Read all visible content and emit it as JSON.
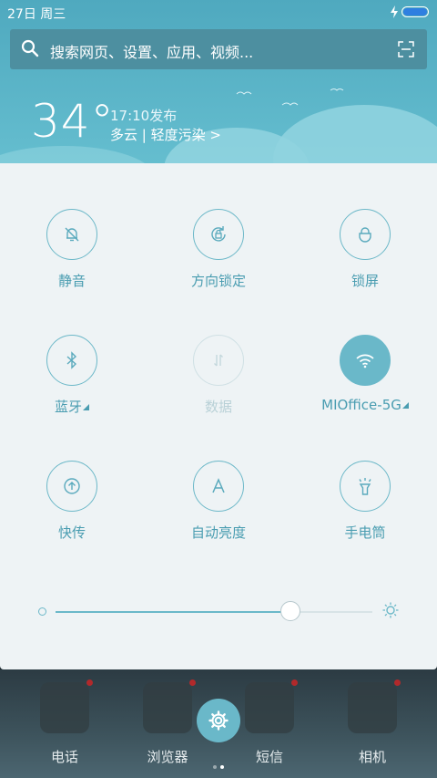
{
  "status": {
    "date_day": "27日 周三"
  },
  "search": {
    "placeholder": "搜索网页、设置、应用、视频..."
  },
  "weather": {
    "temperature": "34°",
    "time": "17:10发布",
    "description": "多云 | 轻度污染 >"
  },
  "toggles": [
    {
      "label": "静音",
      "icon": "mute-bell-icon",
      "state": "off"
    },
    {
      "label": "方向锁定",
      "icon": "rotation-lock-icon",
      "state": "off"
    },
    {
      "label": "锁屏",
      "icon": "lock-icon",
      "state": "off"
    },
    {
      "label": "蓝牙",
      "icon": "bluetooth-icon",
      "state": "off"
    },
    {
      "label": "数据",
      "icon": "mobile-data-icon",
      "state": "disabled"
    },
    {
      "label": "MIOffice-5G",
      "icon": "wifi-icon",
      "state": "on"
    },
    {
      "label": "快传",
      "icon": "share-transfer-icon",
      "state": "off"
    },
    {
      "label": "自动亮度",
      "icon": "auto-brightness-icon",
      "state": "off"
    },
    {
      "label": "手电筒",
      "icon": "flashlight-icon",
      "state": "off"
    }
  ],
  "brightness": {
    "level": 0.74
  },
  "dock": {
    "apps": [
      {
        "name": "电话"
      },
      {
        "name": "浏览器"
      },
      {
        "name": "短信"
      },
      {
        "name": "相机"
      }
    ]
  },
  "colors": {
    "accent": "#6ab8c9",
    "label": "#4a9db1",
    "panel": "#eef3f5"
  }
}
